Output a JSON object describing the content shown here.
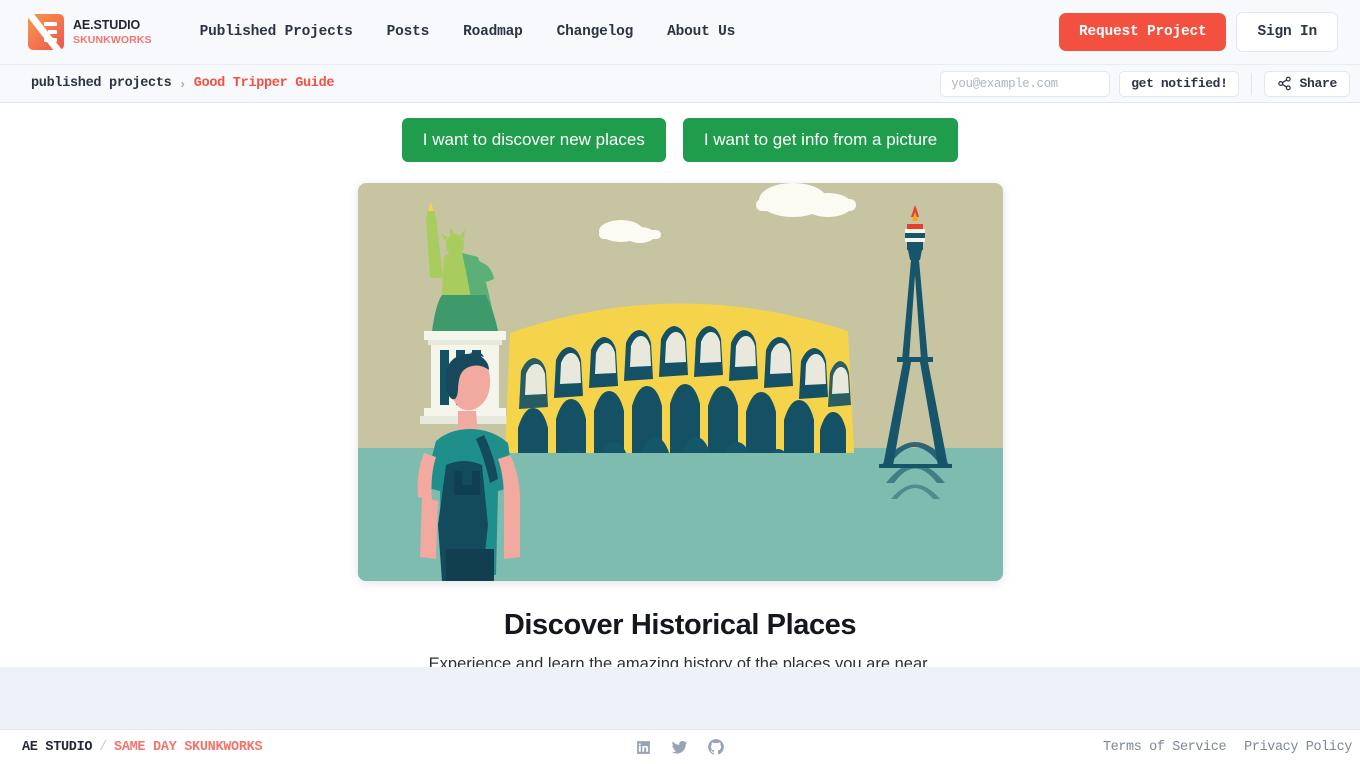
{
  "brand": {
    "name_top": "AE.STUDIO",
    "name_sub": "SKUNKWORKS",
    "logo_icon": "ae-studio-logo-icon",
    "accent_red": "#f4503f",
    "accent_salmon": "#f2746c"
  },
  "nav": {
    "items": [
      {
        "label": "Published Projects"
      },
      {
        "label": "Posts"
      },
      {
        "label": "Roadmap"
      },
      {
        "label": "Changelog"
      },
      {
        "label": "About Us"
      }
    ],
    "request_label": "Request Project",
    "signin_label": "Sign In"
  },
  "breadcrumb": {
    "root": "published projects",
    "separator": "›",
    "current": "Good Tripper Guide",
    "email_placeholder": "you@example.com",
    "email_value": "",
    "notify_label": "get notified!",
    "share_label": "Share",
    "share_icon": "share-icon"
  },
  "main": {
    "cta_primary": "I want to discover new places",
    "cta_secondary": "I want to get info from a picture",
    "headline": "Discover Historical Places",
    "subhead": "Experience and learn the amazing history of the places you are near.",
    "illustration": {
      "name": "historical-places-illustration",
      "sky_color": "#c7c4a1",
      "ground_color": "#7dbcae",
      "colosseum_color": "#f5d44c",
      "dark_teal": "#145164",
      "statue_light": "#a9cc5e",
      "statue_mid": "#5bb077",
      "statue_dark": "#3f9a6b",
      "pedestal_color": "#f4f6ec",
      "cloud_color": "#fbfbf3",
      "skin_color": "#f2a9a0",
      "shirt_color": "#1f8f8c",
      "flame_red": "#e4402f",
      "flame_orange": "#f5a623"
    }
  },
  "footer": {
    "studio": "AE STUDIO",
    "slash": "/",
    "tagline": "SAME DAY SKUNKWORKS",
    "social": [
      {
        "name": "linkedin-icon"
      },
      {
        "name": "twitter-icon"
      },
      {
        "name": "github-icon"
      }
    ],
    "links": [
      {
        "label": "Terms of Service"
      },
      {
        "label": "Privacy Policy"
      }
    ]
  }
}
